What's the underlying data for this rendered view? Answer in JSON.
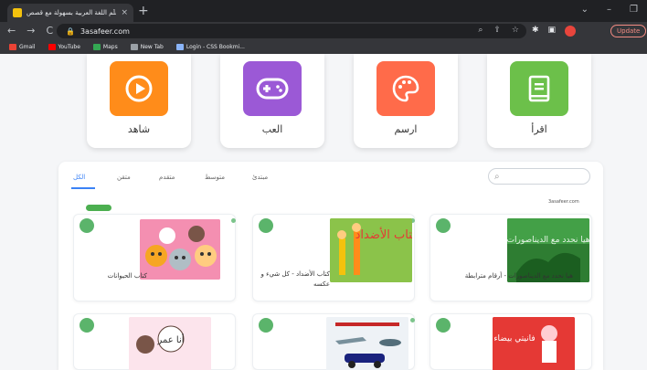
{
  "browser": {
    "tab_title": "تعلّم اللغة العربية بسهولة مع قصص",
    "tab_close": "×",
    "new_tab": "+",
    "url": "3asafeer.com",
    "nav_back": "←",
    "nav_forward": "→",
    "nav_reload": "C",
    "update_label": "Update",
    "bookmarks": [
      {
        "label": "Gmail",
        "color": "#ea4335"
      },
      {
        "label": "YouTube",
        "color": "#ff0000"
      },
      {
        "label": "Maps",
        "color": "#34a853"
      },
      {
        "label": "New Tab",
        "color": "#9aa0a6"
      },
      {
        "label": "Login - CSS Bookmi...",
        "color": "#8ab4f8"
      }
    ]
  },
  "categories": [
    {
      "label": "اقرأ",
      "color": "#6cc04a",
      "icon": "book-icon"
    },
    {
      "label": "ارسم",
      "color": "#ff6b4a",
      "icon": "palette-icon"
    },
    {
      "label": "العب",
      "color": "#9b59d6",
      "icon": "gamepad-icon"
    },
    {
      "label": "شاهد",
      "color": "#ff8c1a",
      "icon": "play-icon"
    }
  ],
  "filters": [
    "الكل",
    "متقن",
    "متقدم",
    "متوسط",
    "مبتدئ"
  ],
  "search_icon": "search-icon",
  "source_label": "3asafeer.com",
  "books": [
    {
      "title": "هيا نحدد مع الديناصورات - أرقام مترابطة",
      "cover_color": "#2e7d32"
    },
    {
      "title": "كتاب الأضداد - كل شيء و عكسه",
      "cover_color": "#8bc34a"
    },
    {
      "title": "كتاب الحيوانات",
      "cover_color": "#f48fb1"
    },
    {
      "title": "",
      "cover_color": "#e53935"
    },
    {
      "title": "",
      "cover_color": "#eef2f6"
    },
    {
      "title": "",
      "cover_color": "#fce4ec"
    }
  ],
  "cover_texts": {
    "dino": "هيا نحدد مع الديناصورات",
    "opposites": "كتاب الأضداد",
    "animals": "",
    "red": "فانيتي بيضاء",
    "ships": "",
    "girl": "أنا عمر"
  }
}
